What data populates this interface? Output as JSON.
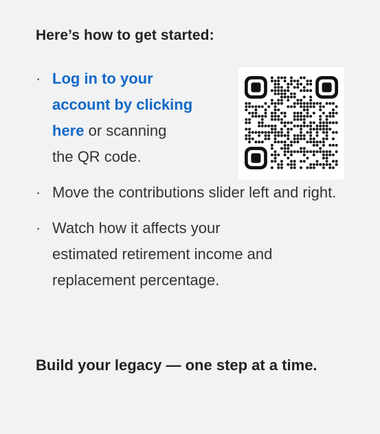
{
  "heading": "Here’s how to get started:",
  "steps": {
    "login": {
      "link_text": "Log in to your account by clicking here",
      "rest_line1": " or scanning",
      "rest_line2": "the QR code."
    },
    "slider": "Move the contributions slider left and right.",
    "watch": "Watch how it affects your estimated retirement income and replacement percentage."
  },
  "qr": {
    "icon": "qr-code-icon"
  },
  "footer": "Build your legacy — one step at a time.",
  "colors": {
    "background": "#f1f2f3",
    "link": "#1268c8",
    "text": "#222222"
  }
}
